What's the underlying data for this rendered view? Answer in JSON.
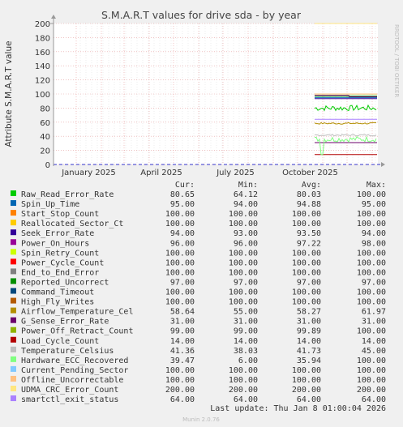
{
  "title": "S.M.A.R.T values for drive sda - by year",
  "watermark": "RRDTOOL / TOBI OETIKER",
  "footer": "Munin 2.0.76",
  "last_update": "Last update: Thu Jan  8 01:00:04 2026",
  "colors": {
    "background": "#f0f0f0",
    "plot_bg": "#ffffff",
    "grid_major": "#e6a0a0",
    "grid_minor": "#e0e0e0"
  },
  "legend_headers": {
    "cur": "Cur:",
    "min": "Min:",
    "avg": "Avg:",
    "max": "Max:"
  },
  "chart_data": {
    "type": "line",
    "title": "S.M.A.R.T values for drive sda - by year",
    "ylabel": "Attribute S.M.A.R.T value",
    "xlabel": "",
    "ylim": [
      0,
      200
    ],
    "yticks": [
      0,
      20,
      40,
      60,
      80,
      100,
      120,
      140,
      160,
      180,
      200
    ],
    "xticks": [
      "January 2025",
      "April 2025",
      "July 2025",
      "October 2025"
    ],
    "grid": true,
    "data_start": "2025-10-22",
    "series": [
      {
        "name": "Raw_Read_Error_Rate",
        "color": "#00cc00",
        "cur": "80.65",
        "min": "64.12",
        "avg": "80.03",
        "max": "100.00",
        "style": "noisy",
        "value": 80
      },
      {
        "name": "Spin_Up_Time",
        "color": "#0066b3",
        "cur": "95.00",
        "min": "94.00",
        "avg": "94.88",
        "max": "95.00",
        "style": "flat",
        "value": 95
      },
      {
        "name": "Start_Stop_Count",
        "color": "#ff8000",
        "cur": "100.00",
        "min": "100.00",
        "avg": "100.00",
        "max": "100.00",
        "style": "flat",
        "value": 100
      },
      {
        "name": "Reallocated_Sector_Ct",
        "color": "#ffcc00",
        "cur": "100.00",
        "min": "100.00",
        "avg": "100.00",
        "max": "100.00",
        "style": "flat",
        "value": 100
      },
      {
        "name": "Seek_Error_Rate",
        "color": "#330099",
        "cur": "94.00",
        "min": "93.00",
        "avg": "93.50",
        "max": "94.00",
        "style": "flat",
        "value": 93.5
      },
      {
        "name": "Power_On_Hours",
        "color": "#990099",
        "cur": "96.00",
        "min": "96.00",
        "avg": "97.22",
        "max": "98.00",
        "style": "step",
        "value": 97
      },
      {
        "name": "Spin_Retry_Count",
        "color": "#ccff00",
        "cur": "100.00",
        "min": "100.00",
        "avg": "100.00",
        "max": "100.00",
        "style": "flat",
        "value": 100
      },
      {
        "name": "Power_Cycle_Count",
        "color": "#ff0000",
        "cur": "100.00",
        "min": "100.00",
        "avg": "100.00",
        "max": "100.00",
        "style": "flat",
        "value": 100
      },
      {
        "name": "End_to_End_Error",
        "color": "#808080",
        "cur": "100.00",
        "min": "100.00",
        "avg": "100.00",
        "max": "100.00",
        "style": "flat",
        "value": 100
      },
      {
        "name": "Reported_Uncorrect",
        "color": "#008f00",
        "cur": "97.00",
        "min": "97.00",
        "avg": "97.00",
        "max": "97.00",
        "style": "flat",
        "value": 97
      },
      {
        "name": "Command_Timeout",
        "color": "#00487d",
        "cur": "100.00",
        "min": "100.00",
        "avg": "100.00",
        "max": "100.00",
        "style": "flat",
        "value": 100
      },
      {
        "name": "High_Fly_Writes",
        "color": "#b35a00",
        "cur": "100.00",
        "min": "100.00",
        "avg": "100.00",
        "max": "100.00",
        "style": "flat",
        "value": 100
      },
      {
        "name": "Airflow_Temperature_Cel",
        "color": "#b38f00",
        "cur": "58.64",
        "min": "55.00",
        "avg": "58.27",
        "max": "61.97",
        "style": "noisy",
        "value": 58.3
      },
      {
        "name": "G_Sense_Error_Rate",
        "color": "#6b006b",
        "cur": "31.00",
        "min": "31.00",
        "avg": "31.00",
        "max": "31.00",
        "style": "flat",
        "value": 31
      },
      {
        "name": "Power_Off_Retract_Count",
        "color": "#8fb300",
        "cur": "99.00",
        "min": "99.00",
        "avg": "99.89",
        "max": "100.00",
        "style": "flat",
        "value": 99.9
      },
      {
        "name": "Load_Cycle_Count",
        "color": "#b30000",
        "cur": "14.00",
        "min": "14.00",
        "avg": "14.00",
        "max": "14.00",
        "style": "flat",
        "value": 14
      },
      {
        "name": "Temperature_Celsius",
        "color": "#bebebe",
        "cur": "41.36",
        "min": "38.03",
        "avg": "41.73",
        "max": "45.00",
        "style": "noisy",
        "value": 41.7
      },
      {
        "name": "Hardware_ECC_Recovered",
        "color": "#80ff80",
        "cur": "39.47",
        "min": "6.00",
        "avg": "35.94",
        "max": "100.00",
        "style": "noisy",
        "value": 35.9
      },
      {
        "name": "Current_Pending_Sector",
        "color": "#80c9ff",
        "cur": "100.00",
        "min": "100.00",
        "avg": "100.00",
        "max": "100.00",
        "style": "flat",
        "value": 100
      },
      {
        "name": "Offline_Uncorrectable",
        "color": "#ffc080",
        "cur": "100.00",
        "min": "100.00",
        "avg": "100.00",
        "max": "100.00",
        "style": "flat",
        "value": 100
      },
      {
        "name": "UDMA_CRC_Error_Count",
        "color": "#ffe680",
        "cur": "200.00",
        "min": "200.00",
        "avg": "200.00",
        "max": "200.00",
        "style": "flat",
        "value": 200
      },
      {
        "name": "smartctl_exit_status",
        "color": "#aa80ff",
        "cur": "64.00",
        "min": "64.00",
        "avg": "64.00",
        "max": "64.00",
        "style": "flat",
        "value": 64
      }
    ]
  }
}
